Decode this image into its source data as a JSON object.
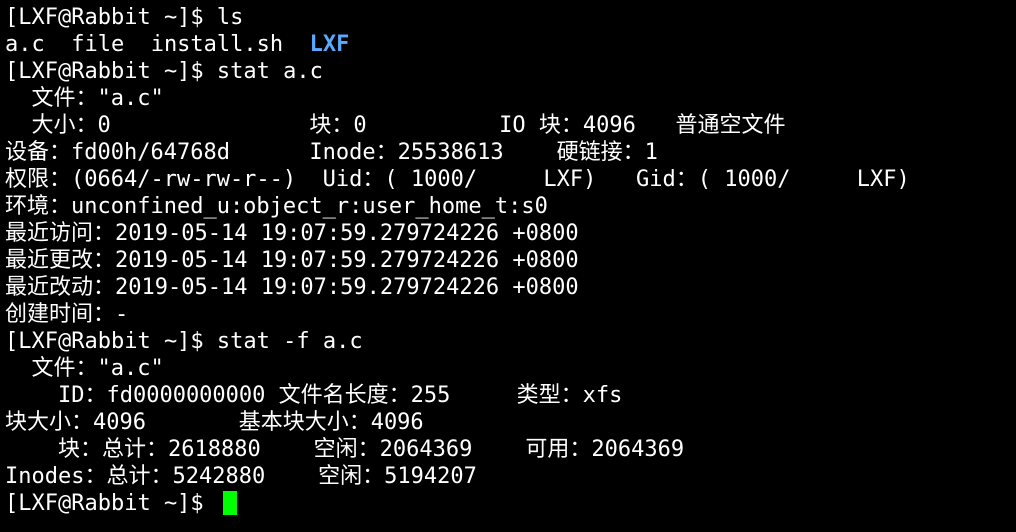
{
  "terminal": {
    "lines": [
      "[LXF@Rabbit ~]$ ls",
      "",
      "[LXF@Rabbit ~]$ stat a.c",
      "  文件：\"a.c\"",
      "  大小：0               块：0          IO 块：4096   普通空文件",
      "设备：fd00h/64768d      Inode：25538613    硬链接：1",
      "权限：(0664/-rw-rw-r--)  Uid：( 1000/     LXF)   Gid：( 1000/     LXF)",
      "环境：unconfined_u:object_r:user_home_t:s0",
      "最近访问：2019-05-14 19:07:59.279724226 +0800",
      "最近更改：2019-05-14 19:07:59.279724226 +0800",
      "最近改动：2019-05-14 19:07:59.279724226 +0800",
      "创建时间：-",
      "[LXF@Rabbit ~]$ stat -f a.c",
      "  文件：\"a.c\"",
      "    ID：fd0000000000 文件名长度：255     类型：xfs",
      "块大小：4096       基本块大小：4096",
      "    块：总计：2618880    空闲：2064369    可用：2064369",
      "Inodes：总计：5242880    空闲：5194207",
      ""
    ],
    "ls_output": {
      "files": "a.c  file  install.sh  ",
      "directory": "LXF"
    },
    "prompt": "[LXF@Rabbit ~]$ ",
    "colors": {
      "background": "#000000",
      "foreground": "#ffffff",
      "directory": "#5aa9ff",
      "cursor": "#00ff00"
    }
  }
}
